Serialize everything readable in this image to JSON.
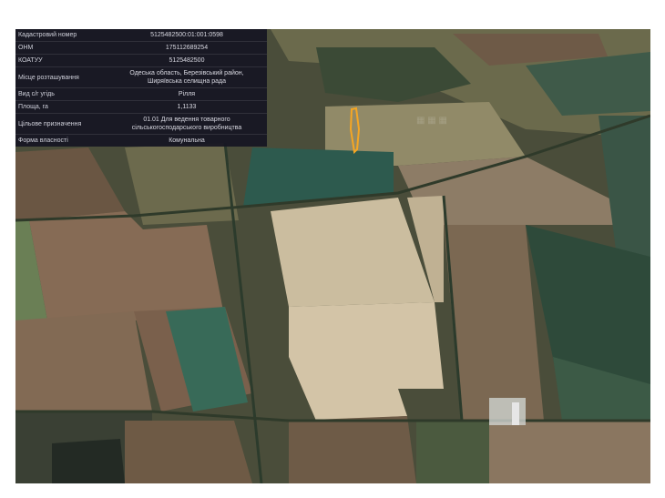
{
  "info_panel": {
    "rows": [
      {
        "label": "Кадастровий номер",
        "value": "5125482500:01:001:0598"
      },
      {
        "label": "ОНМ",
        "value": "175112689254"
      },
      {
        "label": "КОАТУУ",
        "value": "5125482500"
      },
      {
        "label": "Місце розташування",
        "value": "Одеська область, Березівський район,\nШиряївська селищна рада"
      },
      {
        "label": "Вид с/г угідь",
        "value": "Рілля"
      },
      {
        "label": "Площа, га",
        "value": "1,1133"
      },
      {
        "label": "Цільове призначення",
        "value": "01.01 Для ведення товарного\nсільськогосподарського виробництва"
      },
      {
        "label": "Форма власності",
        "value": "Комунальна"
      }
    ]
  },
  "colors": {
    "parcel_outline": "#f5a623",
    "panel_bg": "#16161f",
    "farm_dark": "#3a4632",
    "farm_light": "#d2c3a4",
    "farm_green": "#2f5a4c"
  }
}
